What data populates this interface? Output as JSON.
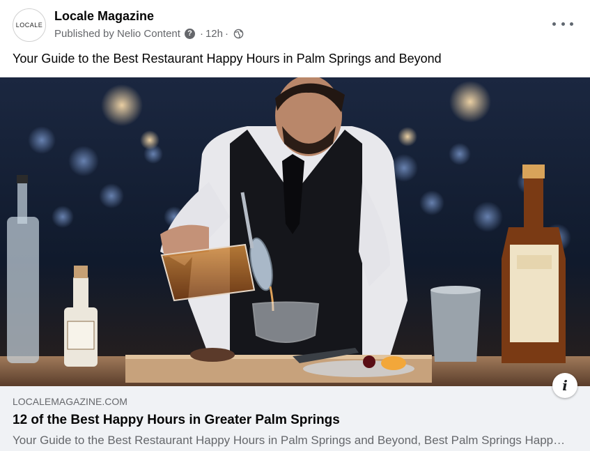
{
  "post": {
    "page_name": "Locale Magazine",
    "avatar_text": "LOCALE",
    "published_by": "Published by Nelio Content",
    "help_glyph": "?",
    "separator": "·",
    "time": "12h",
    "audience_icon": "globe-icon",
    "more_icon": "more-horizontal-icon",
    "text": "Your Guide to the Best Restaurant Happy Hours in Palm Springs and Beyond"
  },
  "photo": {
    "description_icon": "info-icon",
    "info_glyph": "i",
    "colors": {
      "background": "#0f1a2c",
      "bokeh": "#6f8cc9",
      "warm_light": "#e9c08a",
      "bar_wood": "#6b4a34"
    }
  },
  "link": {
    "domain": "LOCALEMAGAZINE.COM",
    "title": "12 of the Best Happy Hours in Greater Palm Springs",
    "description": "Your Guide to the Best Restaurant Happy Hours in Palm Springs and Beyond, Best Palm Springs Happy Hours"
  },
  "colors": {
    "secondary_text": "#65676b",
    "link_bg": "#f0f2f5",
    "primary_text": "#050505"
  }
}
